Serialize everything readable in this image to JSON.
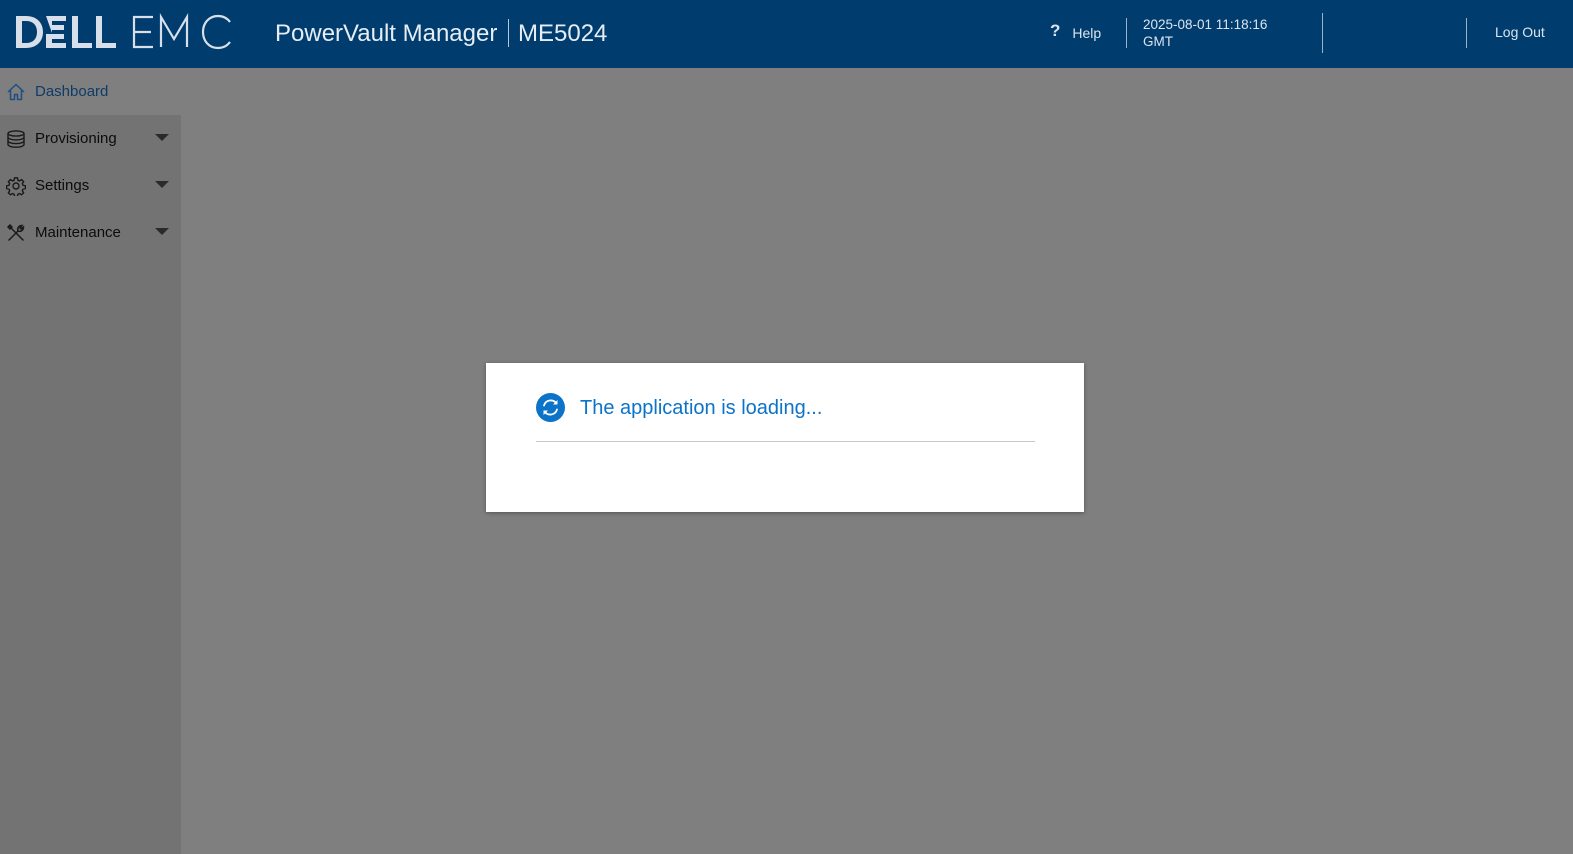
{
  "header": {
    "brand": "DELLEMC",
    "product": "PowerVault Manager",
    "model": "ME5024",
    "help_label": "Help",
    "help_icon": "?",
    "datetime_line1": "2025-08-01 11:18:16",
    "datetime_line2": "GMT",
    "logout_label": "Log Out"
  },
  "sidebar": {
    "items": [
      {
        "label": "Dashboard",
        "icon": "home-icon",
        "expandable": false,
        "active": true
      },
      {
        "label": "Provisioning",
        "icon": "database-icon",
        "expandable": true,
        "active": false
      },
      {
        "label": "Settings",
        "icon": "gear-icon",
        "expandable": true,
        "active": false
      },
      {
        "label": "Maintenance",
        "icon": "tools-icon",
        "expandable": true,
        "active": false
      }
    ]
  },
  "dialog": {
    "message": "The application is loading...",
    "icon": "refresh-icon"
  },
  "colors": {
    "header_bg": "#003c6d",
    "page_bg": "#7f7f7f",
    "sidebar_bg": "#737373",
    "accent_blue": "#0b73c8"
  }
}
